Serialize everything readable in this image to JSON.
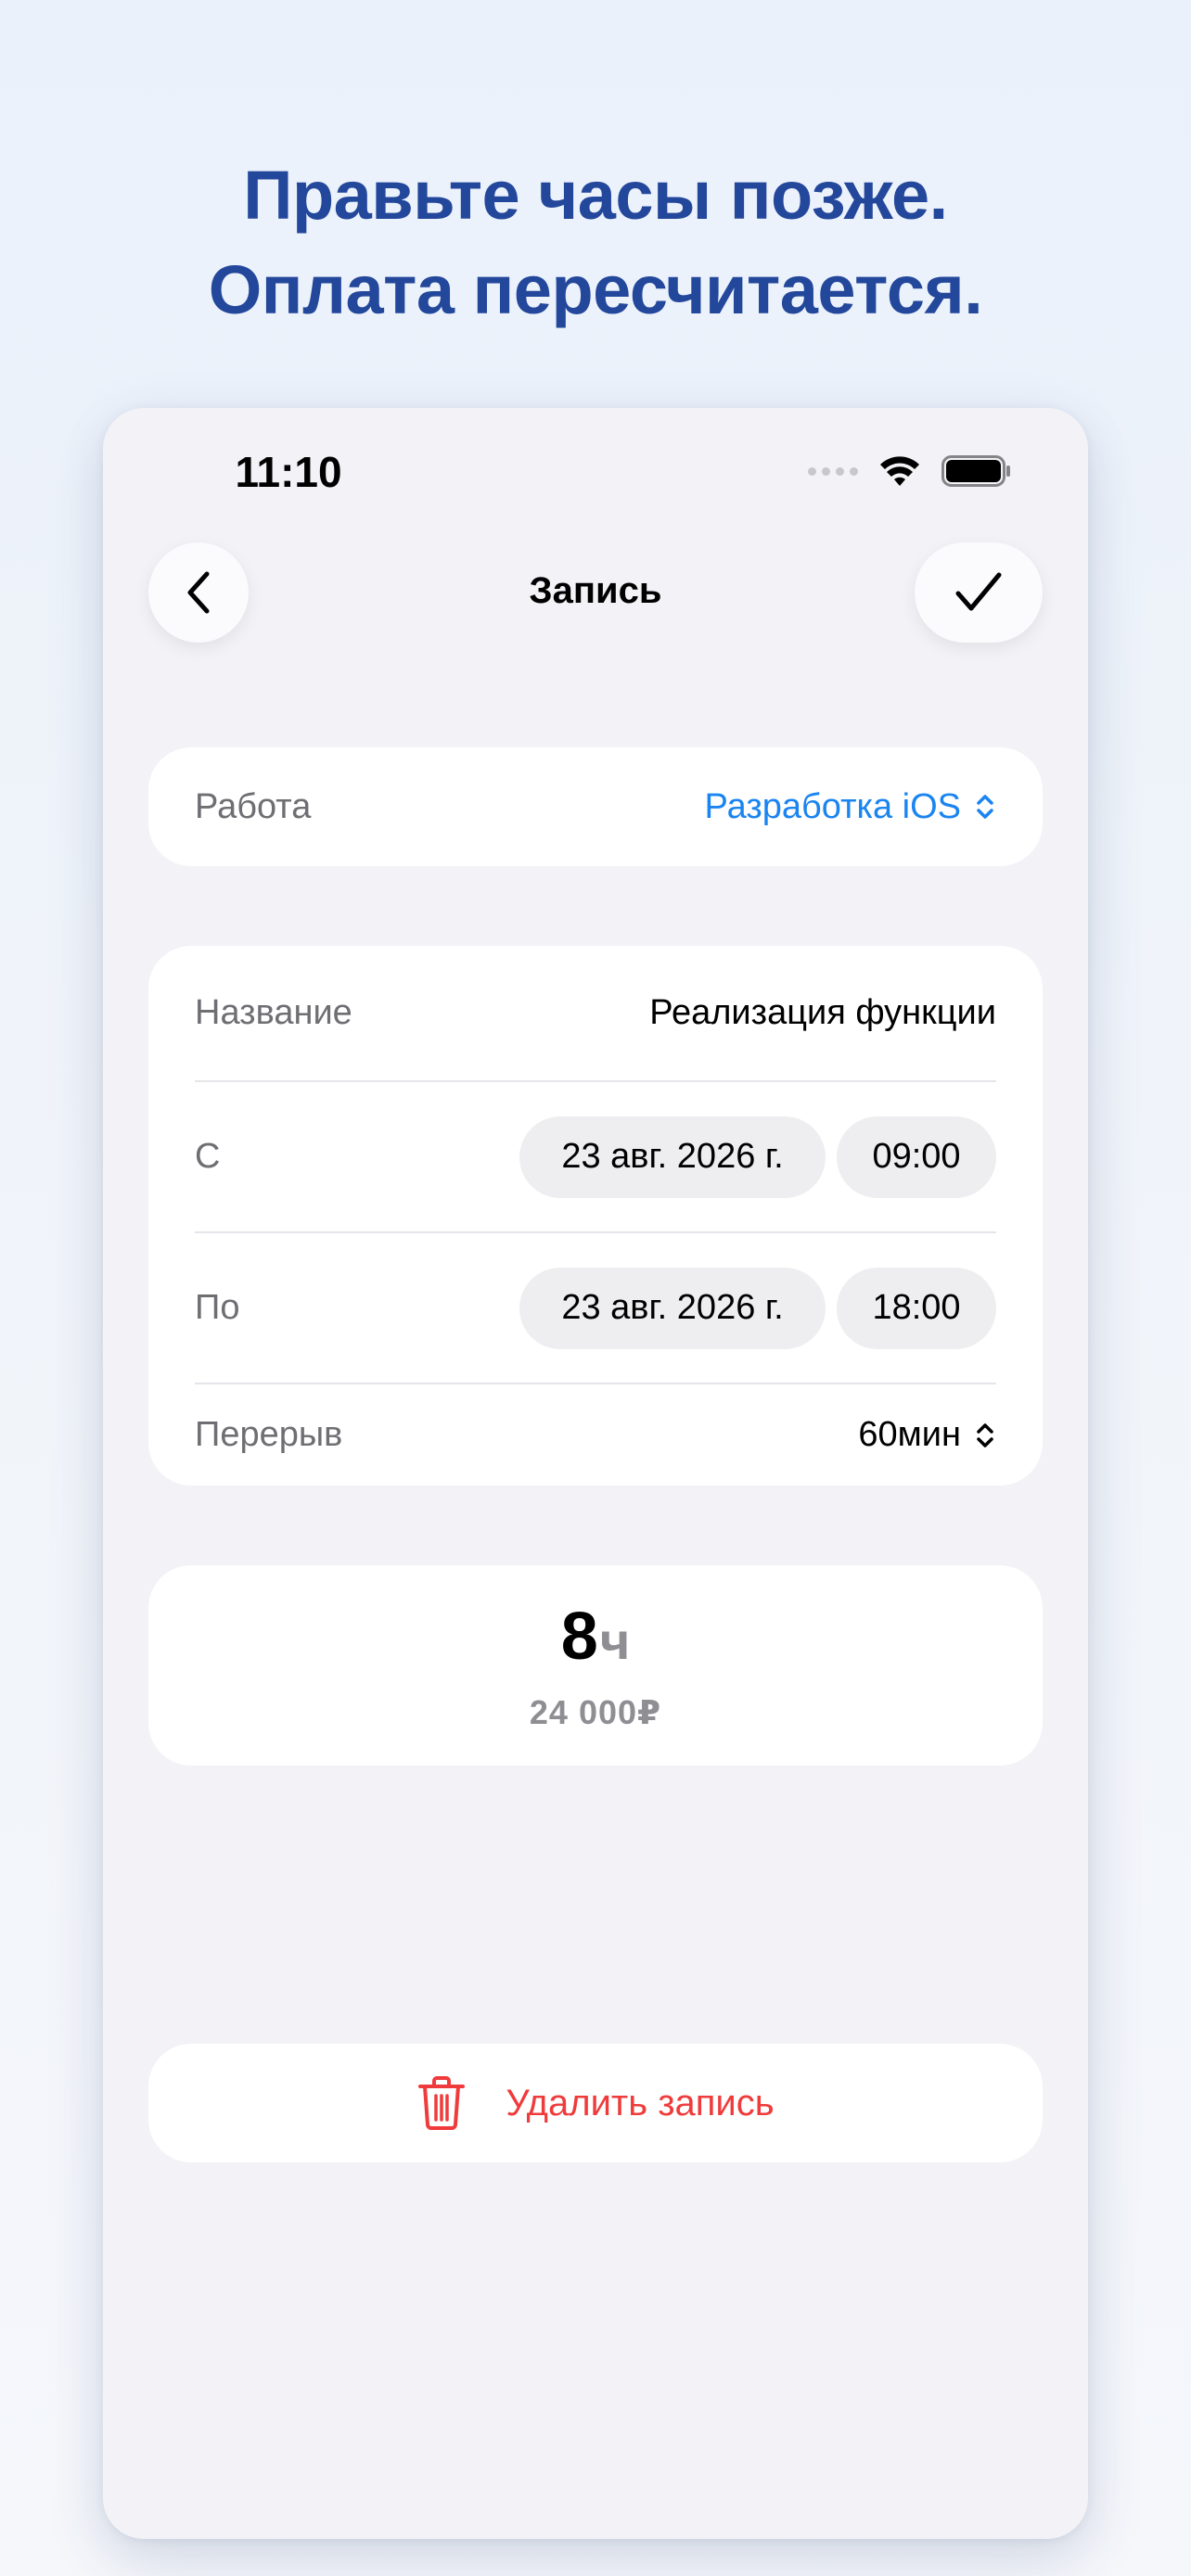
{
  "headline": {
    "line1": "Правьте часы позже.",
    "line2": "Оплата пересчитается."
  },
  "status_bar": {
    "time": "11:10"
  },
  "nav": {
    "title": "Запись",
    "back_icon": "chevron-left-icon",
    "done_icon": "checkmark-icon"
  },
  "job": {
    "label": "Работа",
    "value": "Разработка iOS"
  },
  "details": {
    "name_label": "Название",
    "name_value": "Реализация функции",
    "from_label": "С",
    "from_date": "23 авг. 2026 г.",
    "from_time": "09:00",
    "to_label": "По",
    "to_date": "23 авг. 2026 г.",
    "to_time": "18:00",
    "break_label": "Перерыв",
    "break_value": "60мин"
  },
  "total": {
    "hours": "8",
    "unit": "ч",
    "pay": "24 000₽"
  },
  "delete": {
    "label": "Удалить запись"
  },
  "colors": {
    "headline": "#23479b",
    "accent": "#1a84f0",
    "destructive": "#ef3b3b",
    "background": "#f2f2f7"
  }
}
